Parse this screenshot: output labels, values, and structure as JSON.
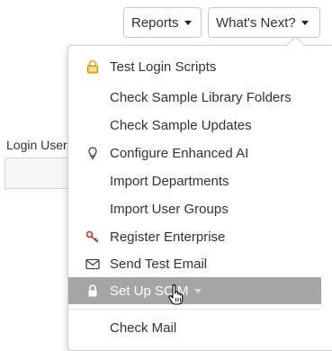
{
  "toolbar": {
    "reports_label": "Reports",
    "whats_next_label": "What's Next?"
  },
  "form": {
    "login_label": "Login User"
  },
  "menu": {
    "items": [
      {
        "label": "Test Login Scripts",
        "icon": "lock-scripts-icon"
      },
      {
        "label": "Check Sample Library Folders",
        "icon": ""
      },
      {
        "label": "Check Sample Updates",
        "icon": ""
      },
      {
        "label": "Configure Enhanced AI",
        "icon": "lightbulb-icon"
      },
      {
        "label": "Import Departments",
        "icon": ""
      },
      {
        "label": "Import User Groups",
        "icon": ""
      },
      {
        "label": "Register Enterprise",
        "icon": "key-icon"
      },
      {
        "label": "Send Test Email",
        "icon": "envelope-icon"
      },
      {
        "label": "Set Up SCIM",
        "icon": "lock-icon",
        "active": true,
        "has_submenu": true
      },
      {
        "label": "Check Mail",
        "icon": ""
      }
    ]
  },
  "colors": {
    "active_bg": "#a5a5a5",
    "key_icon": "#c0392b",
    "lock_scripts_icon": "#e8a317"
  }
}
